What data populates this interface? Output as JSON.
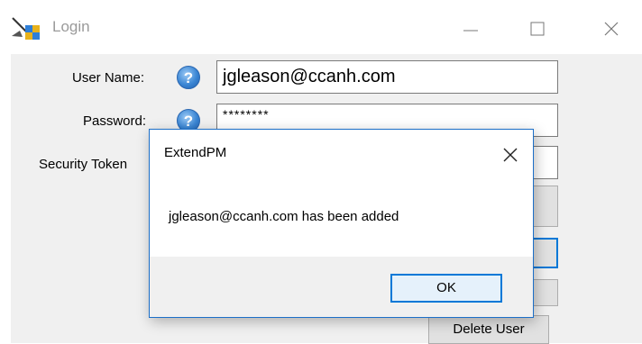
{
  "window": {
    "title": "Login",
    "controls": {
      "minimize_icon": "minimize-icon",
      "maximize_icon": "maximize-icon",
      "close_icon": "close-icon"
    }
  },
  "form": {
    "username_label": "User Name:",
    "username_value": "jgleason@ccanh.com",
    "password_label": "Password:",
    "password_value": "********",
    "token_label": "Security Token",
    "help_glyph": "?",
    "delete_button": "Delete User"
  },
  "dialog": {
    "title": "ExtendPM",
    "message": "jgleason@ccanh.com has been added",
    "ok_label": "OK"
  },
  "colors": {
    "accent": "#0078d7",
    "client_bg": "#f0f0f0",
    "help_icon": "#3b86d4"
  }
}
